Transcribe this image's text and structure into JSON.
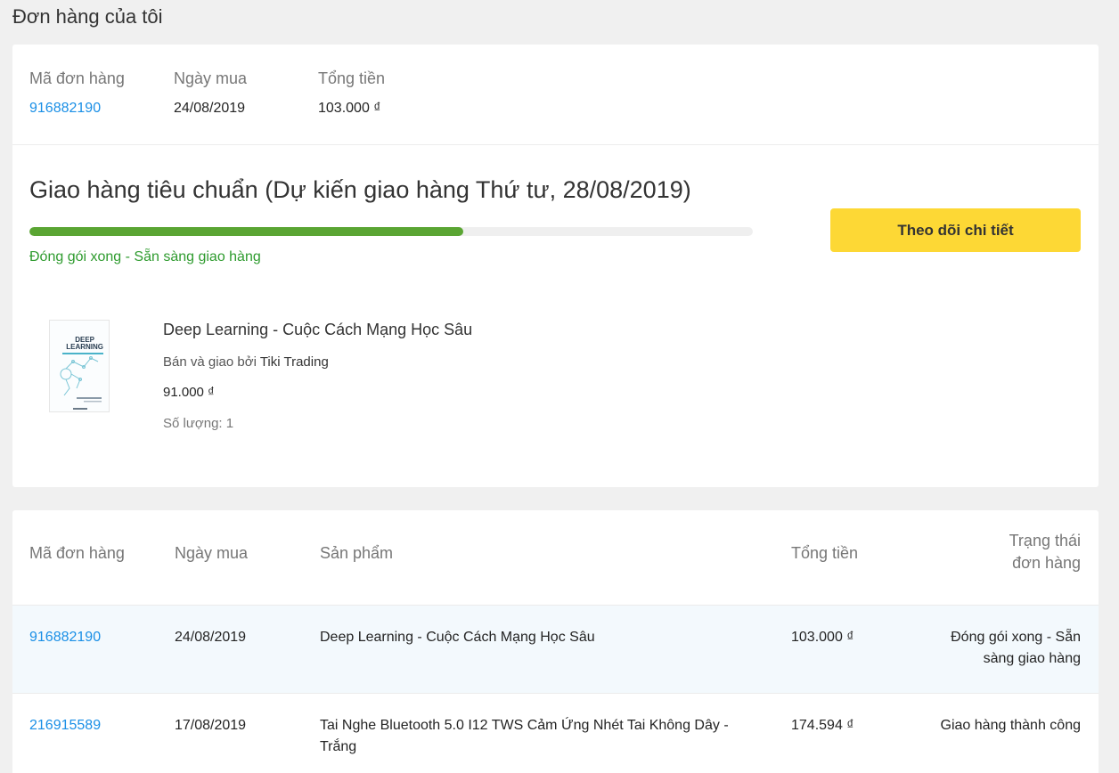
{
  "page_title": "Đơn hàng của tôi",
  "order": {
    "labels": {
      "order_id": "Mã đơn hàng",
      "date": "Ngày mua",
      "total": "Tổng tiền"
    },
    "order_id": "916882190",
    "date": "24/08/2019",
    "total": "103.000 ₫",
    "shipping_title": "Giao hàng tiêu chuẩn (Dự kiến giao hàng Thứ tư, 28/08/2019)",
    "progress_fraction": 0.6,
    "status_text": "Đóng gói xong - Sẵn sàng giao hàng",
    "track_button_label": "Theo dõi chi tiết",
    "product": {
      "name": "Deep Learning - Cuộc Cách Mạng Học Sâu",
      "seller_prefix": "Bán và giao bởi",
      "seller_name": "Tiki Trading",
      "price": "91.000 ₫",
      "quantity_label": "Số lượng: 1",
      "cover_title_1": "DEEP",
      "cover_title_2": "LEARNING"
    }
  },
  "table": {
    "headers": {
      "order_id": "Mã đơn hàng",
      "date": "Ngày mua",
      "product": "Sản phẩm",
      "total": "Tổng tiền",
      "status_1": "Trạng thái",
      "status_2": "đơn hàng"
    },
    "rows": [
      {
        "order_id": "916882190",
        "date": "24/08/2019",
        "product_1": "Deep Learning - Cuộc Cách Mạng Học Sâu",
        "product_2": "",
        "total": "103.000 ₫",
        "status_1": "Đóng gói xong - Sẵn",
        "status_2": "sàng giao hàng"
      },
      {
        "order_id": "216915589",
        "date": "17/08/2019",
        "product_1": "Tai Nghe Bluetooth 5.0 I12 TWS Cảm Ứng Nhét Tai Không Dây -",
        "product_2": "Trắng",
        "total": "174.594 ₫",
        "status_1": "Giao hàng thành công",
        "status_2": ""
      }
    ]
  },
  "colors": {
    "link": "#1a8fe6",
    "progress_fill": "#5aa533",
    "status_green": "#2e9b2e",
    "button_yellow": "#fdd835"
  }
}
